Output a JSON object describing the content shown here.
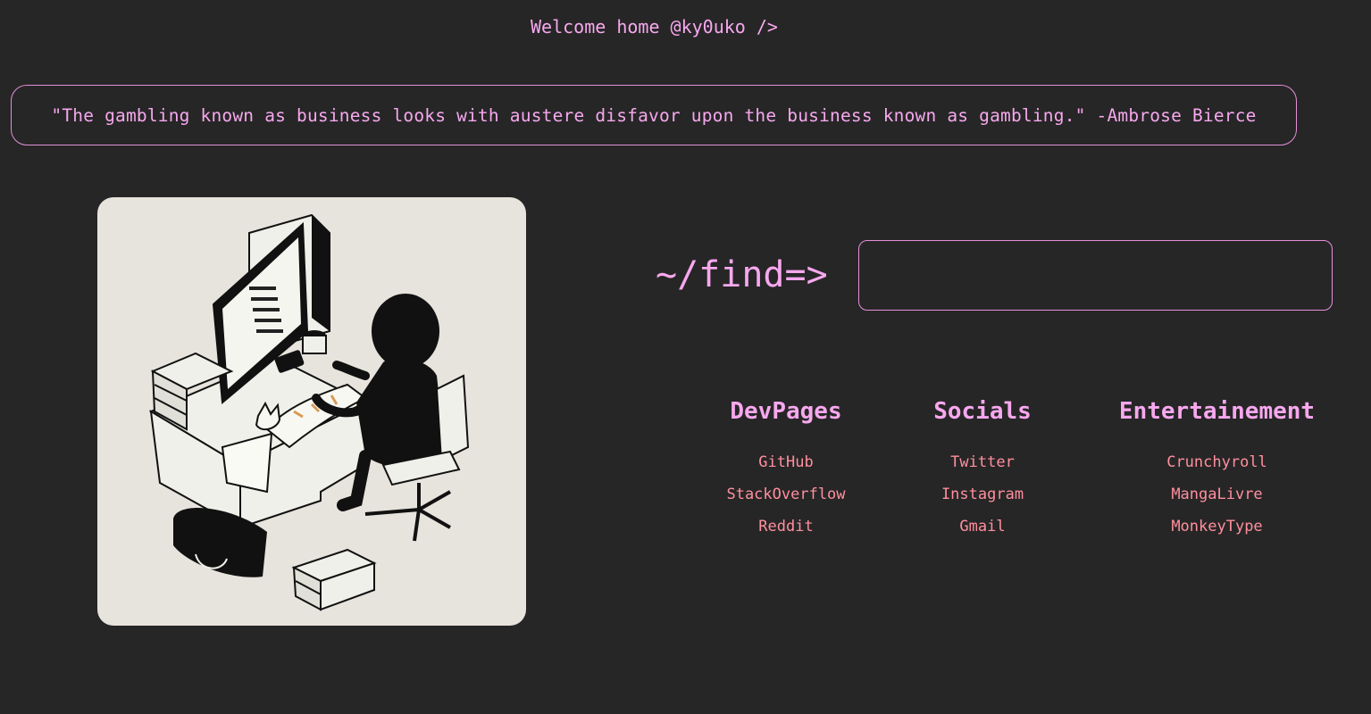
{
  "header": {
    "welcome": "Welcome home @ky0uko />"
  },
  "quote": {
    "text": "\"The gambling known as business looks with austere disfavor upon the business known as gambling.\" -Ambrose Bierce"
  },
  "search": {
    "prompt": "~/find=>",
    "value": "",
    "placeholder": ""
  },
  "links": {
    "devpages": {
      "title": "DevPages",
      "items": [
        "GitHub",
        "StackOverflow",
        "Reddit"
      ]
    },
    "socials": {
      "title": "Socials",
      "items": [
        "Twitter",
        "Instagram",
        "Gmail"
      ]
    },
    "entertainment": {
      "title": "Entertainement",
      "items": [
        "Crunchyroll",
        "MangaLivre",
        "MonkeyType"
      ]
    }
  },
  "colors": {
    "background": "#262626",
    "accent_pink": "#f7a8ee",
    "link_coral": "#ff8f9e",
    "art_background": "#e7e3dd"
  }
}
